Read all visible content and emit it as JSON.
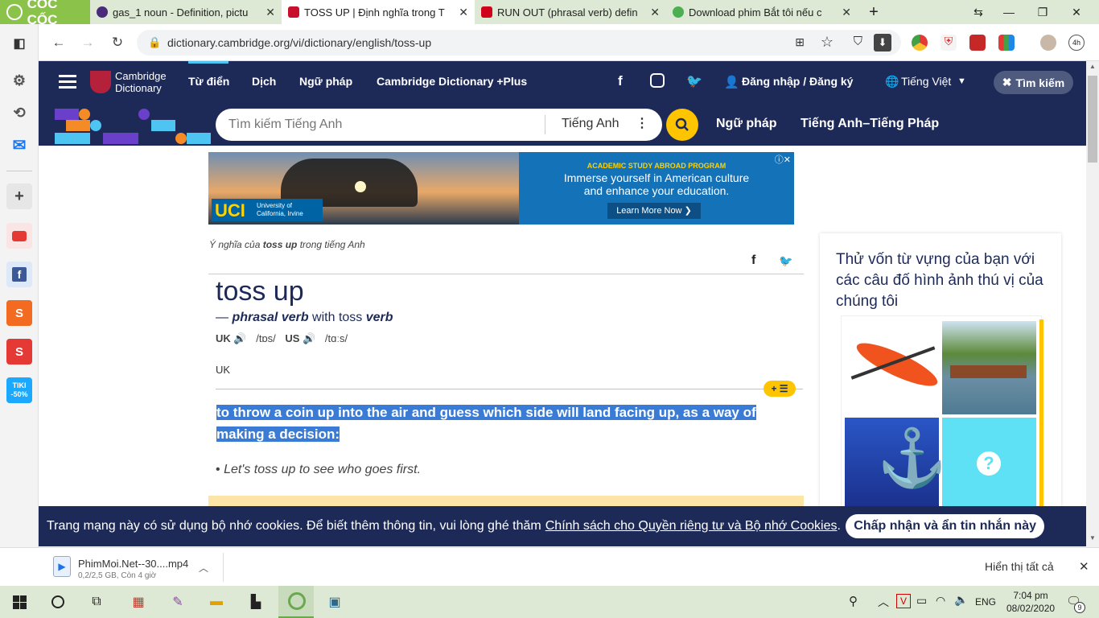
{
  "browser": {
    "brand": "CỐC CỐC",
    "tabs": [
      {
        "title": "gas_1 noun - Definition, pictu",
        "active": false
      },
      {
        "title": "TOSS UP | Định nghĩa trong T",
        "active": true
      },
      {
        "title": "RUN OUT (phrasal verb) defin",
        "active": false
      },
      {
        "title": "Download phim Bắt tôi nếu c",
        "active": false
      }
    ],
    "new_tab": "+",
    "url": "dictionary.cambridge.org/vi/dictionary/english/toss-up"
  },
  "header": {
    "logo_line1": "Cambridge",
    "logo_line2": "Dictionary",
    "nav": [
      "Từ điển",
      "Dịch",
      "Ngữ pháp",
      "Cambridge Dictionary +Plus"
    ],
    "login": "Đăng nhập / Đăng ký",
    "language": "Tiếng Việt",
    "search_toggle": "Tìm kiếm"
  },
  "searchbar": {
    "placeholder": "Tìm kiếm Tiếng Anh",
    "dictionary": "Tiếng Anh",
    "links": [
      "Ngữ pháp",
      "Tiếng Anh–Tiếng Pháp"
    ]
  },
  "ad": {
    "uci": "UCI",
    "uci_line1": "University of",
    "uci_line2": "California, Irvine",
    "program": "ACADEMIC STUDY ABROAD PROGRAM",
    "line1": "Immerse yourself in American culture",
    "line2": "and enhance your education.",
    "cta": "Learn More Now"
  },
  "entry": {
    "crumb_pre": "Ý nghĩa của ",
    "crumb_word": "toss up",
    "crumb_post": " trong tiếng Anh",
    "headword": "toss up",
    "dash": "— ",
    "pos": "phrasal verb",
    "with": " with toss ",
    "verb": "verb",
    "uk_label": "UK",
    "uk_ipa": "/tɒs/",
    "us_label": "US",
    "us_ipa": "/tɑːs/",
    "region": "UK",
    "plus_badge": "+ ☰",
    "definition": "to throw a coin up into the air and guess which side will land facing up, as a way of making a decision:",
    "example_bullet": "•",
    "example": "Let's toss up to see who goes first."
  },
  "quiz": {
    "title": "Thử vốn từ vựng của bạn với các câu đố hình ảnh thú vị của chúng tôi",
    "question_mark": "?"
  },
  "cookie": {
    "text": "Trang mạng này có sử dụng bộ nhớ cookies. Để biết thêm thông tin, vui lòng ghé thăm",
    "link": "Chính sách cho Quyền riêng tư và Bộ nhớ Cookies",
    "period": ".",
    "accept": "Chấp nhận và ẩn tin nhắn này"
  },
  "download": {
    "file": "PhimMoi.Net--30....mp4",
    "status": "0,2/2,5 GB, Còn 4 giờ",
    "show_all": "Hiển thị tất cả"
  },
  "taskbar": {
    "lang": "ENG",
    "time": "7:04 pm",
    "date": "08/02/2020",
    "notif": "9",
    "ime": "V"
  },
  "sidebar_labels": {
    "tiki": "TIKI",
    "tiki_pct": "-50%"
  },
  "colors": {
    "cam_navy": "#1d2a57",
    "cam_yellow": "#fec400",
    "highlight": "#3a7bd5",
    "coccoc_green": "#8bc34a"
  }
}
